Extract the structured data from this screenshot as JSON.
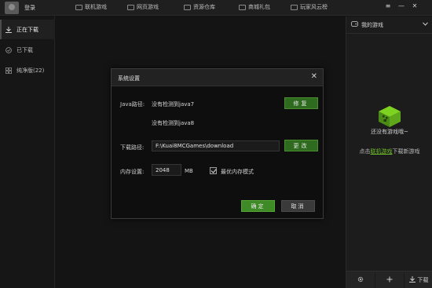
{
  "topbar": {
    "login": "登录",
    "nav": [
      {
        "label": "联机游戏",
        "icon": "gamepad-icon"
      },
      {
        "label": "网页游戏",
        "icon": "monitor-icon"
      },
      {
        "label": "资源仓库",
        "icon": "box-icon"
      },
      {
        "label": "商城礼包",
        "icon": "gift-icon"
      },
      {
        "label": "玩家风云榜",
        "icon": "cup-icon"
      }
    ],
    "window": {
      "menu": "≡",
      "minimize": "—",
      "maximize": "□",
      "close": "✕"
    }
  },
  "sidebar": {
    "items": [
      {
        "label": "正在下载",
        "icon": "download-icon",
        "active": true
      },
      {
        "label": "已下载",
        "icon": "check-circle-icon",
        "active": false
      },
      {
        "label": "纯净版(22)",
        "icon": "grid-icon",
        "active": false
      }
    ]
  },
  "right_panel": {
    "header": "我的游戏",
    "empty_text": "还没有游戏哦~",
    "hint_prefix": "点击",
    "hint_link": "联机游戏",
    "hint_suffix": "下载新游戏",
    "footer": {
      "download_label": "下载",
      "settings_icon": "gear-icon",
      "add_icon": "plus-icon"
    }
  },
  "dialog": {
    "title": "系统设置",
    "java_label": "Java路径:",
    "java_value_1": "没有检测到java7",
    "java_value_2": "没有检测到java8",
    "repair_button": "修复",
    "download_path_label": "下载路径:",
    "download_path_value": "F:\\Kuai8MCGames\\download",
    "change_button": "更改",
    "memory_label": "内存设置:",
    "memory_value": "2048",
    "memory_unit": "MB",
    "optimal_memory_label": "最优内存模式",
    "optimal_memory_checked": true,
    "ok_button": "确定",
    "cancel_button": "取消"
  },
  "colors": {
    "accent": "#3e8a26",
    "link": "#6fbf2a",
    "background": "#141414"
  }
}
